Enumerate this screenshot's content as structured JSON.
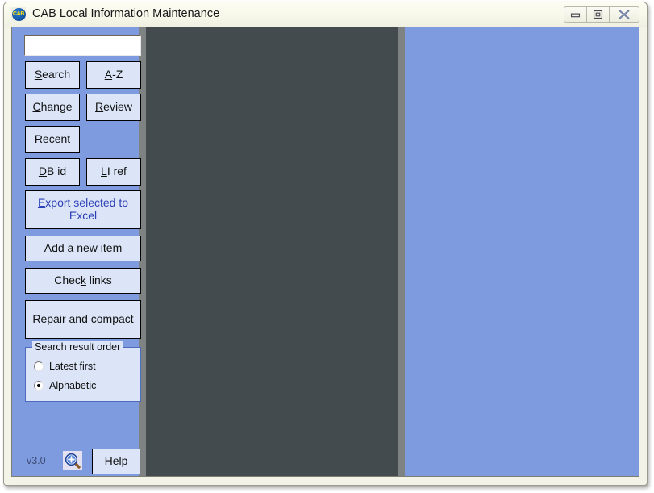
{
  "window": {
    "title": "CAB Local Information Maintenance",
    "app_icon": "cab-logo-icon",
    "app_icon_text": "CAB",
    "controls": [
      {
        "name": "minimize",
        "icon": "minimize-icon",
        "label": "Minimize"
      },
      {
        "name": "maximize",
        "icon": "restore-icon",
        "label": "Restore"
      },
      {
        "name": "close",
        "icon": "close-icon",
        "label": "Close"
      }
    ]
  },
  "sidebar": {
    "search": {
      "value": "",
      "placeholder": ""
    },
    "buttons": [
      {
        "id": "search",
        "label": "Search",
        "accel": "S",
        "style": "dark"
      },
      {
        "id": "az",
        "label": "A-Z",
        "accel": "A",
        "style": "dark"
      },
      {
        "id": "change",
        "label": "Change",
        "accel": "C",
        "style": "dark"
      },
      {
        "id": "review",
        "label": "Review",
        "accel": "R",
        "style": "dark"
      },
      {
        "id": "recent",
        "label": "Recent",
        "accel": "t",
        "style": "dark"
      },
      {
        "id": "dbid",
        "label": "DB id",
        "accel": "D",
        "style": "dark"
      },
      {
        "id": "liref",
        "label": "LI ref",
        "accel": "L",
        "style": "dark"
      },
      {
        "id": "export",
        "label": "Export selected to Excel",
        "accel": "E",
        "style": "blue"
      },
      {
        "id": "addnew",
        "label": "Add a new item",
        "accel": "n",
        "style": "dark"
      },
      {
        "id": "check",
        "label": "Check links",
        "accel": "k",
        "style": "dark"
      },
      {
        "id": "repair",
        "label": "Repair and compact",
        "accel": "p",
        "style": "dark"
      }
    ],
    "search_order": {
      "legend": "Search result order",
      "options": [
        {
          "label": "Latest first",
          "selected": false
        },
        {
          "label": "Alphabetic",
          "selected": true
        }
      ]
    },
    "footer": {
      "version": "v3.0",
      "zoom_icon": "magnifier-plus-icon",
      "help_label": "Help",
      "help_accel": "H"
    }
  },
  "panels": {
    "list_panel": {
      "content": "",
      "background": "#434b4f"
    },
    "detail_panel": {
      "content": "",
      "background": "#7f9be0"
    }
  },
  "colors": {
    "sidebar_background": "#7f9be0",
    "button_face": "#dbe5f7",
    "list_panel": "#434b4f",
    "splitter": "#7e8283",
    "accent_blue_text": "#2b3fb8",
    "title_bar": "#f7f7ea"
  }
}
